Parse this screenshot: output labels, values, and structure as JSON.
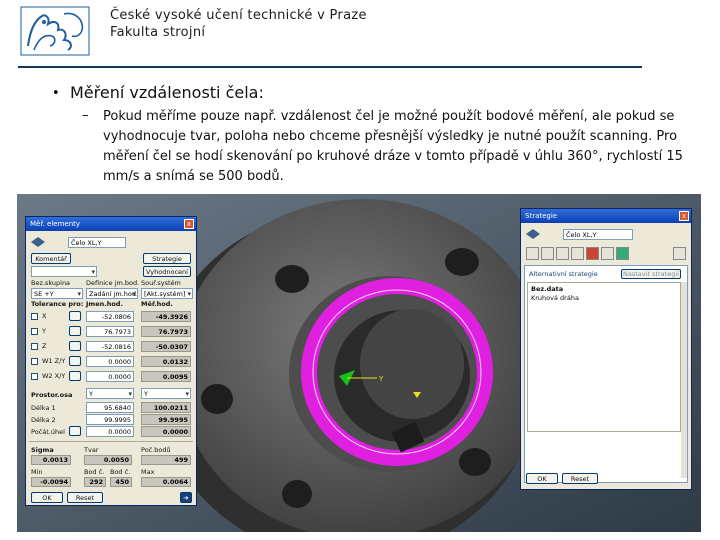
{
  "header": {
    "university": "České vysoké učení technické v Praze",
    "faculty": "Fakulta strojní"
  },
  "slide": {
    "bullet": "•",
    "heading": "Měření vzdálenosti čela:",
    "dash": "–",
    "paragraph": "Pokud měříme pouze např. vzdálenost čel je možné použít bodové měření, ale pokud se vyhodnocuje tvar, poloha nebo chceme přesnější výsledky je nutné použít scanning. Pro měření čel se hodí skenování po kruhové dráze v tomto případě v úhlu 360°, rychlostí 15 mm/s a snímá se 500 bodů."
  },
  "colors": {
    "accent_line": "#15395c",
    "ring": "#e020e0",
    "part": "#5b5b5b"
  },
  "left_window": {
    "title": "Měř. elementy",
    "close": "x",
    "name_field": "Čelo XL,Y",
    "comment_button": "Komentář",
    "strategy_button": "Strategie",
    "evaluation_button": "Vyhodnocení",
    "ref_group_label": "Bez.skupina",
    "ref_group_value": "SE +Y",
    "definition_label": "Definice jm.bod.",
    "definition_value": "Zadání jm.hod.",
    "coord_system_label": "Souř.systém",
    "coord_system_value": "[Akt.systém]",
    "tolerances_label": "Tolerance pro:",
    "nominal_label": "Jmen.hod.",
    "measured_label": "Měř.hod.",
    "rows": [
      {
        "label": "X",
        "nominal": "-52.0806",
        "measured": "-49.3926"
      },
      {
        "label": "Y",
        "nominal": "76.7973",
        "measured": "76.7973"
      },
      {
        "label": "Z",
        "nominal": "-52.0816",
        "measured": "-50.0307"
      },
      {
        "label": "W1 Z/Y",
        "nominal": "0.0000",
        "measured": "0.0132"
      },
      {
        "label": "W2 X/Y",
        "nominal": "0.0000",
        "measured": "0.0095"
      }
    ],
    "space_axis_label": "Prostor.osa",
    "space_axis_value": "Y",
    "space_axis_measured": "Y",
    "length1_label": "Délka 1",
    "length1_nominal": "95.6840",
    "length1_measured": "100.0211",
    "length2_label": "Délka 2",
    "length2_nominal": "99.9995",
    "length2_measured": "99.9995",
    "angle_label": "Počát.úhel",
    "angle_nominal": "0.0000",
    "angle_measured": "0.0000",
    "stats": {
      "sigma_label": "Sigma",
      "sigma_value": "0.0013",
      "form_label": "Tvar",
      "form_value": "0.0050",
      "points_label": "Poč.bodů",
      "points_value": "499",
      "min_label": "Min",
      "min_value": "-0.0094",
      "pointA_label": "Bod č.",
      "pointA_value": "292",
      "pointB_label": "Bod č.",
      "pointB_value": "450",
      "max_label": "Max",
      "max_value": "0.0064"
    },
    "ok_button": "OK",
    "reset_button": "Reset"
  },
  "right_window": {
    "title": "Strategie",
    "close": "x",
    "name_field": "Čelo XL,Y",
    "alt_strategy_label": "Alternativní strategie",
    "alt_button": "Nastavit strategii",
    "list_items": [
      "Bez.data",
      "Kruhová dráha"
    ],
    "ok_button": "OK",
    "reset_button": "Reset"
  },
  "viewport": {
    "axis_y_label": "Y"
  }
}
